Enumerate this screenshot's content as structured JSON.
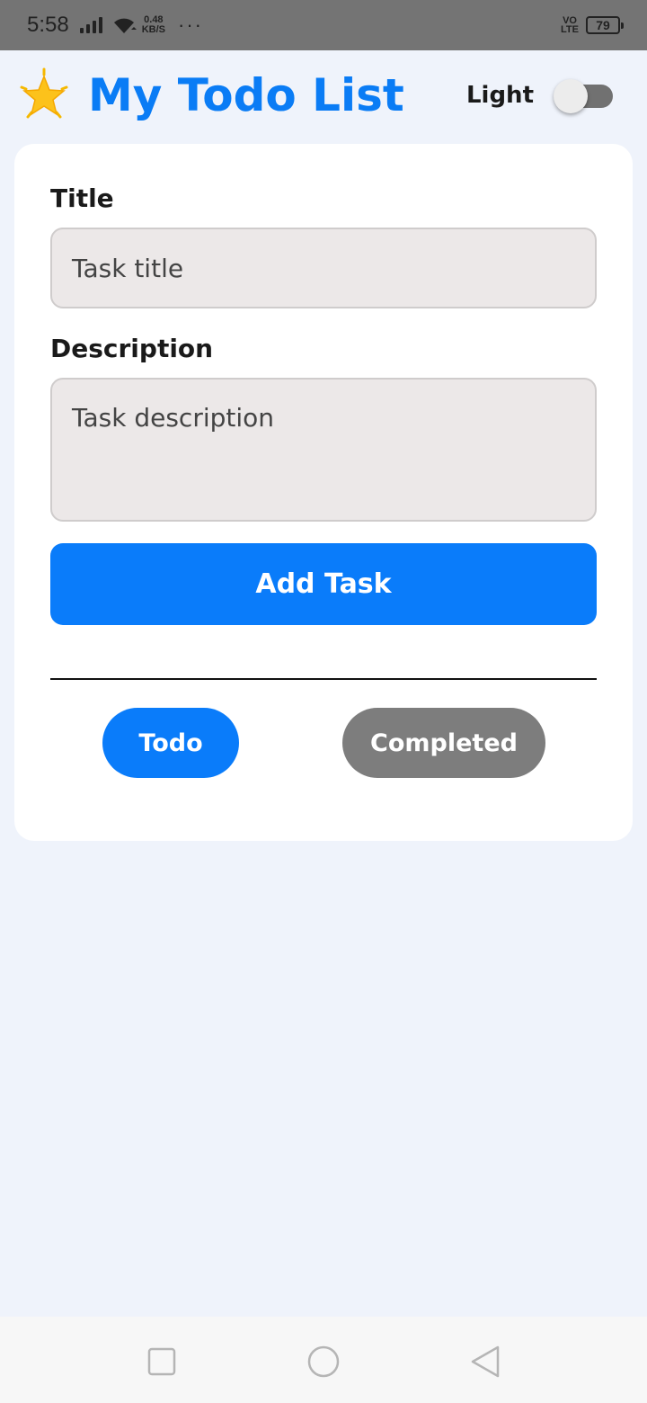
{
  "status_bar": {
    "time": "5:58",
    "net_speed_value": "0.48",
    "net_speed_unit": "KB/S",
    "more": "···",
    "volte_top": "VO",
    "volte_bottom": "LTE",
    "battery": "79"
  },
  "header": {
    "icon": "star-icon",
    "title": "My Todo List",
    "theme_label": "Light",
    "theme_toggle_on": false
  },
  "form": {
    "title_label": "Title",
    "title_placeholder": "Task title",
    "description_label": "Description",
    "description_placeholder": "Task description",
    "add_button": "Add Task"
  },
  "filters": {
    "todo": "Todo",
    "completed": "Completed"
  },
  "colors": {
    "accent": "#0a7cfa",
    "title": "#0a7cf5",
    "inactive_filter": "#7d7d7d",
    "background": "#eff3fb",
    "input_bg": "#ece8e8"
  },
  "nav_bar": {
    "recent": "square-icon",
    "home": "circle-icon",
    "back": "triangle-back-icon"
  }
}
